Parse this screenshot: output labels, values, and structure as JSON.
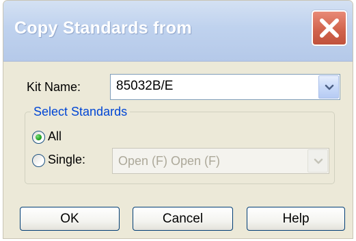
{
  "window": {
    "title": "Copy Standards from"
  },
  "kit": {
    "label": "Kit Name:",
    "value": "85032B/E"
  },
  "group": {
    "legend": "Select Standards",
    "options": [
      {
        "label": "All",
        "selected": true
      },
      {
        "label": "Single:",
        "selected": false
      }
    ],
    "single_combo_value": "Open (F)  Open (F)"
  },
  "buttons": {
    "ok": "OK",
    "cancel": "Cancel",
    "help": "Help"
  },
  "colors": {
    "legend": "#0046d5",
    "close_button": "#d2644d",
    "dialog_background": "#ece9d8"
  }
}
